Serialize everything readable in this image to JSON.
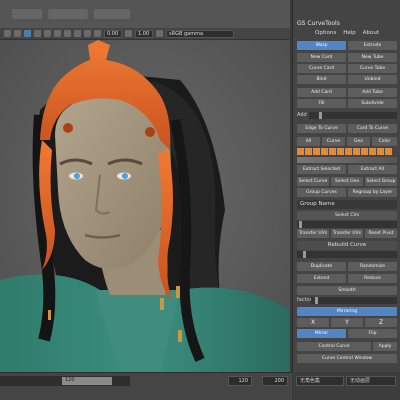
{
  "viewport": {
    "toolbar": {
      "value_a": "0.00",
      "value_b": "1.00",
      "colorspace": "sRGB gamma"
    },
    "timeline": {
      "frame_current": "120",
      "frame_start": "120",
      "frame_end": "200"
    }
  },
  "panel": {
    "title": "GS CurveTools",
    "menu": [
      "Options",
      "Help",
      "About"
    ],
    "buttons": {
      "warp": "Warp",
      "extrude": "Extrude",
      "new_card": "New Card",
      "new_tube": "New Tube",
      "curve_card": "Curve Card",
      "curve_tube": "Curve Tube",
      "bind": "Bind",
      "unbind": "Unbind",
      "add_card": "Add Card",
      "add_tube": "Add Tube",
      "fill": "Fill",
      "subdivide": "Subdivide",
      "edge_to_curve": "Edge To Curve",
      "card_to_curve": "Card To Curve",
      "all": "All",
      "curve": "Curve",
      "geo": "Geo",
      "color": "Color",
      "extract_selected": "Extract Selected",
      "extract_all": "Extract All",
      "select_curve": "Select Curve",
      "select_geo": "Select Geo",
      "select_group": "Select Group",
      "group_curves": "Group Curves",
      "regroup_by_layer": "Regroup by Layer",
      "select_cvs": "Select CVs",
      "transfer_uvs": "Transfer UVs",
      "transfer_uvs_b": "Transfer UVs",
      "reset_pivot": "Reset Pivot",
      "duplicate": "Duplicate",
      "randomize": "Randomize",
      "extend": "Extend",
      "reduce": "Reduce",
      "smooth": "Smooth",
      "mirroring": "Mirroring",
      "x": "X",
      "y": "Y",
      "z": "Z",
      "mirror": "Mirror",
      "flip": "Flip",
      "control_curve": "Control Curve",
      "apply": "Apply",
      "curve_control_window": "Curve Control Window"
    },
    "labels": {
      "add": "Add",
      "group_name_placeholder": "Group Name",
      "rebuild_curve": "Rebuild Curve",
      "factor": "factor"
    },
    "status": {
      "left": "无角色集",
      "right": "无动画层"
    }
  },
  "colors": {
    "accent_blue": "#5285c6",
    "orange": "#e08a3a",
    "crown": "#e0622a"
  }
}
